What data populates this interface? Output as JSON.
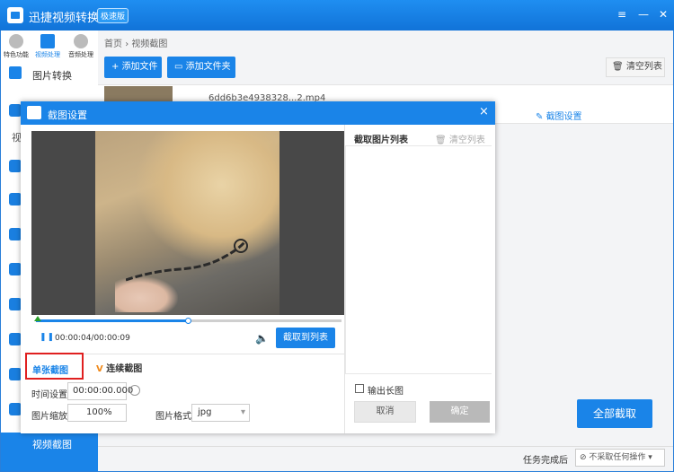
{
  "app": {
    "title": "迅捷视频转换器",
    "edition": "极速版",
    "topics": [
      "特色功能",
      "视频处理",
      "音频处理"
    ],
    "sidebar_visible_item": "图片转换",
    "sidebar_partial_label": "视",
    "sidebar_bottom_label": "视频截图"
  },
  "breadcrumb": {
    "home": "首页",
    "sep": "›",
    "current": "视频截图"
  },
  "toolbar": {
    "add_file": "添加文件",
    "add_folder": "添加文件夹",
    "clear_list": "清空列表"
  },
  "file": {
    "name": "6dd6b3e4938328...2.mp4",
    "settings_label": "截图设置"
  },
  "bottom": {
    "convert_all": "全部截取",
    "task_done_label": "任务完成后",
    "after_option": "不采取任何操作"
  },
  "dialog": {
    "title": "截图设置",
    "close": "×",
    "time_display": "00:00:04/00:00:09",
    "progress_fraction": 0.5,
    "capture_button": "截取到列表",
    "tabs": {
      "single": "单张截图",
      "continuous": "连续截图"
    },
    "fields": {
      "time_label": "时间设置:",
      "time_value": "00:00:00.000",
      "zoom_label": "图片缩放:",
      "zoom_value": "100%",
      "format_label": "图片格式:",
      "format_value": "jpg"
    },
    "list": {
      "title": "截取图片列表",
      "clear": "清空列表",
      "export_long": "输出长图"
    },
    "cancel": "取消",
    "ok": "确定"
  },
  "colors": {
    "accent": "#1a84e8",
    "highlight_border": "#e02020"
  }
}
